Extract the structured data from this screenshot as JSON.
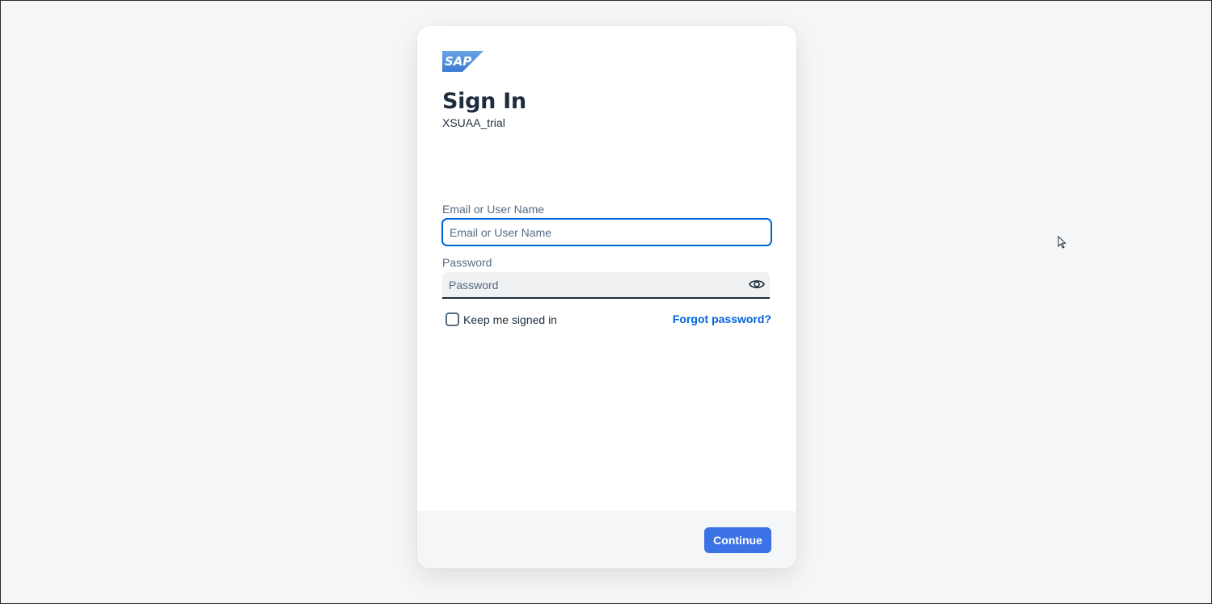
{
  "brand": {
    "logo_text": "SAP",
    "logo_color": "#5b93d8"
  },
  "heading": {
    "title": "Sign In",
    "subtitle": "XSUAA_trial"
  },
  "form": {
    "email_label": "Email or User Name",
    "email_placeholder": "Email or User Name",
    "email_value": "",
    "password_label": "Password",
    "password_placeholder": "Password",
    "password_value": "",
    "show_password_icon": "eye-icon",
    "keep_signed_in_label": "Keep me signed in",
    "keep_signed_in_checked": false,
    "forgot_password_label": "Forgot password?"
  },
  "footer": {
    "continue_label": "Continue"
  },
  "colors": {
    "accent": "#0064d9",
    "button": "#3b73e6",
    "text": "#1d2d3e",
    "muted": "#556b82",
    "background": "#f5f6f7"
  }
}
